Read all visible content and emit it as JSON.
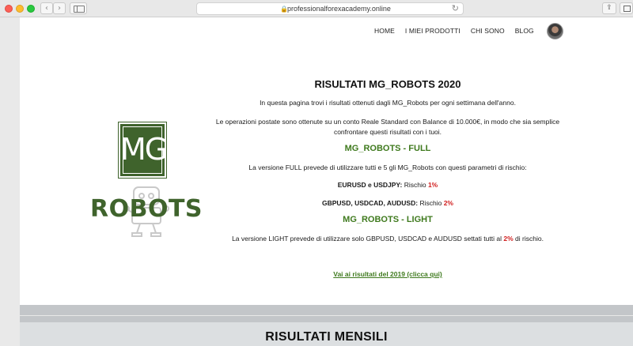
{
  "browser": {
    "url": "professionalforexacademy.online"
  },
  "nav": {
    "items": [
      "HOME",
      "I MIEI PRODOTTI",
      "CHI SONO",
      "BLOG"
    ]
  },
  "logo": {
    "mark": "MG",
    "word": "ROBOTS",
    "color": "#3f632c"
  },
  "content": {
    "title": "RISULTATI MG_ROBOTS 2020",
    "intro": "In questa pagina trovi i risultati ottenuti dagli MG_Robots per ogni settimana dell'anno.",
    "conditions": "Le operazioni postate sono ottenute su un conto Reale Standard con Balance di 10.000€, in modo che sia semplice confrontare questi risultati con i tuoi.",
    "full_heading": "MG_ROBOTS - FULL",
    "full_desc": "La versione FULL prevede di utilizzare tutti e 5 gli MG_Robots con questi parametri di rischio:",
    "risk1_pairs": "EURUSD e USDJPY:",
    "risk1_label": "Rischio",
    "risk1_value": "1%",
    "risk2_pairs": "GBPUSD, USDCAD, AUDUSD:",
    "risk2_label": "Rischio",
    "risk2_value": "2%",
    "light_heading": "MG_ROBOTS - LIGHT",
    "light_desc_a": "La versione LIGHT prevede di utilizzare solo GBPUSD, USDCAD e AUDUSD settati tutti al",
    "light_value": "2%",
    "light_desc_b": "di rischio.",
    "prev_link": "Vai ai risultati del 2019 (clicca qui)"
  },
  "section": {
    "monthly_title": "RISULTATI MENSILI"
  },
  "colors": {
    "accent_green": "#3f7a1e",
    "risk_red": "#d11f1f"
  }
}
